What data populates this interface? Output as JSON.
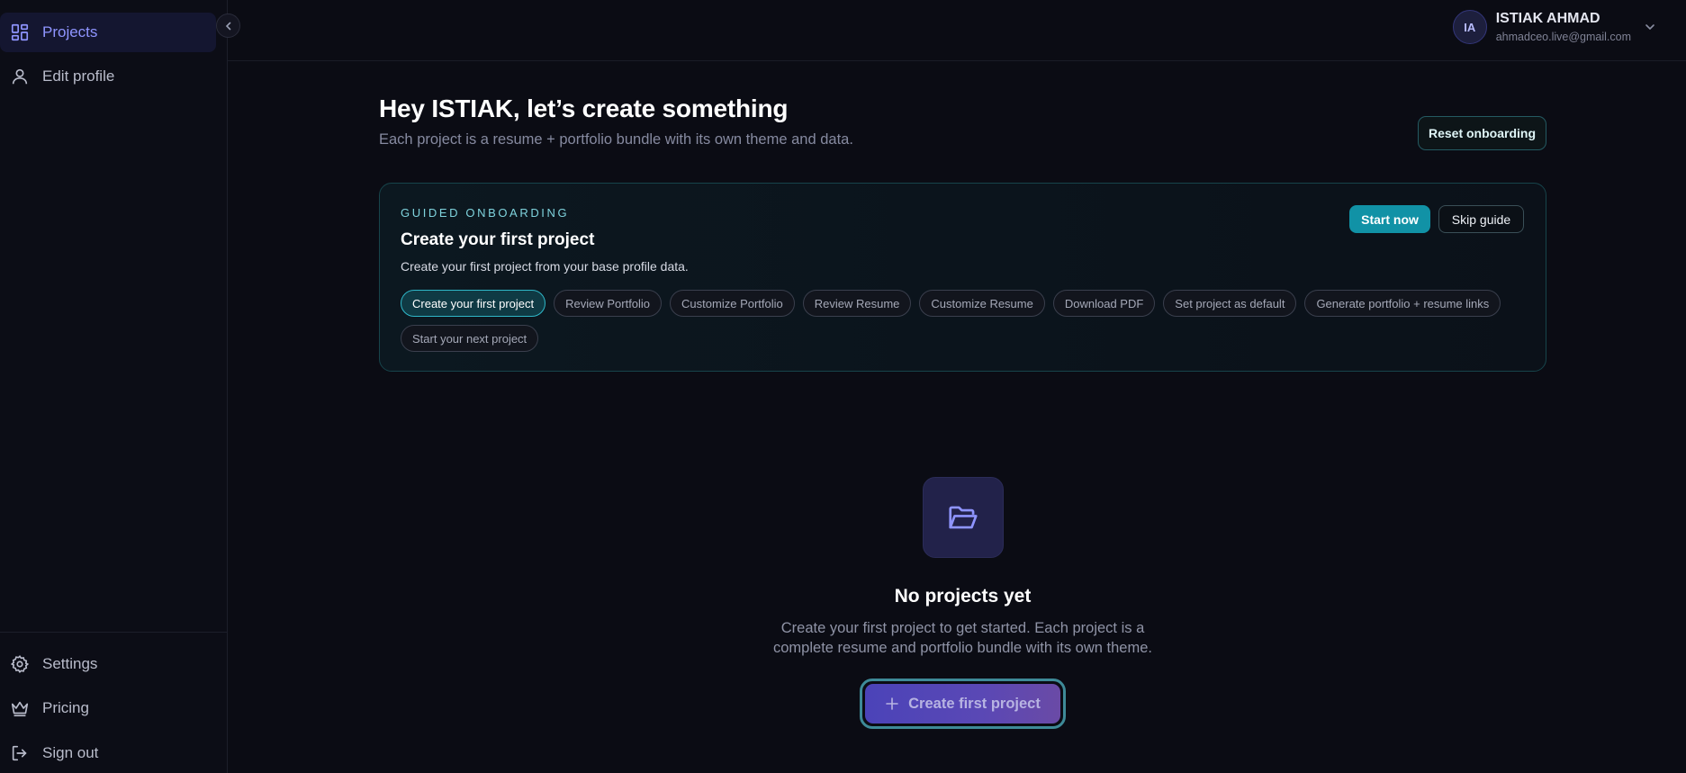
{
  "sidebar": {
    "items": [
      {
        "label": "Projects",
        "icon": "grid-icon"
      },
      {
        "label": "Edit profile",
        "icon": "user-icon"
      }
    ],
    "bottom_items": [
      {
        "label": "Settings",
        "icon": "gear-icon"
      },
      {
        "label": "Pricing",
        "icon": "crown-icon"
      },
      {
        "label": "Sign out",
        "icon": "sign-out-icon"
      }
    ]
  },
  "header": {
    "user": {
      "initials": "IA",
      "name": "ISTIAK AHMAD",
      "email": "ahmadceo.live@gmail.com"
    }
  },
  "main": {
    "title": "Hey ISTIAK, let’s create something",
    "subtitle": "Each project is a resume + portfolio bundle with its own theme and data.",
    "reset_label": "Reset onboarding"
  },
  "onboarding": {
    "eyebrow": "GUIDED ONBOARDING",
    "title": "Create your first project",
    "description": "Create your first project from your base profile data.",
    "start_label": "Start now",
    "skip_label": "Skip guide",
    "steps": [
      "Create your first project",
      "Review Portfolio",
      "Customize Portfolio",
      "Review Resume",
      "Customize Resume",
      "Download PDF",
      "Set project as default",
      "Generate portfolio + resume links",
      "Start your next project"
    ],
    "active_step": 0
  },
  "empty_state": {
    "icon": "folder-open-icon",
    "title": "No projects yet",
    "description": "Create your first project to get started. Each project is a complete resume and portfolio bundle with its own theme.",
    "cta_label": "Create first project"
  },
  "colors": {
    "accent": "#8f95ff",
    "teal": "#1192a6",
    "background": "#0b0c14"
  }
}
